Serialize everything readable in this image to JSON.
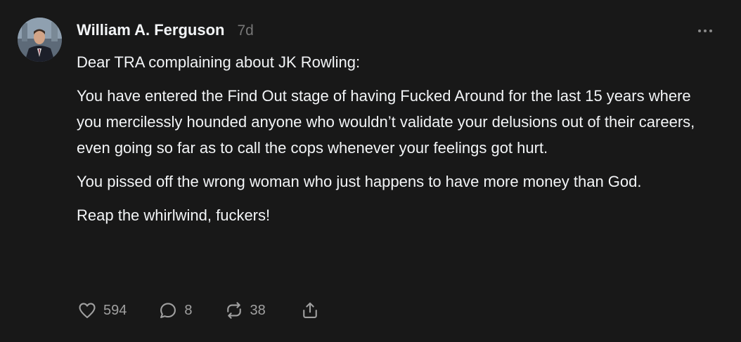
{
  "post": {
    "author": "William A. Ferguson",
    "time": "7d",
    "paragraphs": [
      "Dear TRA complaining about JK Rowling:",
      "You have entered the Find Out stage of having Fucked Around for the last 15 years where you mercilessly hounded anyone who wouldn’t validate your delusions out of their careers, even going so far as to call the cops whenever your feelings got hurt.",
      "You pissed off the wrong woman who just happens to have more money than God.",
      "Reap the whirlwind, fuckers!"
    ],
    "likes": "594",
    "replies": "8",
    "reposts": "38"
  },
  "icons": {
    "more": "more-horizontal-icon",
    "like": "heart-icon",
    "reply": "comment-icon",
    "repost": "repost-icon",
    "share": "share-icon"
  },
  "colors": {
    "background": "#181818",
    "text": "#f3f5f7",
    "muted": "#777777"
  }
}
